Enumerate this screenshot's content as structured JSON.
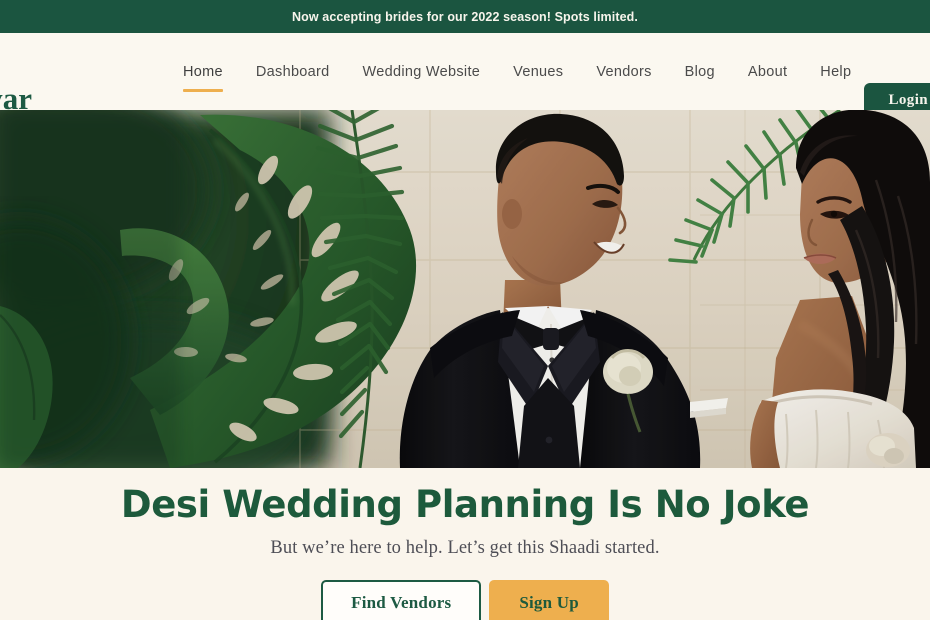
{
  "announcement": {
    "text": "Now accepting brides for our 2022 season! Spots limited."
  },
  "brand": {
    "logo_text": "pyar"
  },
  "nav": {
    "items": [
      {
        "label": "Home",
        "active": true
      },
      {
        "label": "Dashboard",
        "active": false
      },
      {
        "label": "Wedding Website",
        "active": false
      },
      {
        "label": "Venues",
        "active": false
      },
      {
        "label": "Vendors",
        "active": false
      },
      {
        "label": "Blog",
        "active": false
      },
      {
        "label": "About",
        "active": false
      },
      {
        "label": "Help",
        "active": false
      }
    ],
    "login_label": "Login"
  },
  "hero": {
    "alt": "Smiling groom in black tuxedo with white rose boutonniere beside bride in white strapless gown, framed by monstera and palm leaves against a cream tiled wall",
    "headline": "Desi Wedding Planning Is No Joke",
    "subheadline": "But we’re here to help. Let’s get this Shaadi started.",
    "primary_cta": "Find Vendors",
    "secondary_cta": "Sign Up"
  },
  "colors": {
    "brand_green": "#1b5540",
    "accent_amber": "#eeaf4e",
    "cream_bg": "#faf5ec",
    "nav_bg": "#fbf8f0",
    "nav_text": "#4b4b4b",
    "headline_green": "#1d5a3c"
  }
}
